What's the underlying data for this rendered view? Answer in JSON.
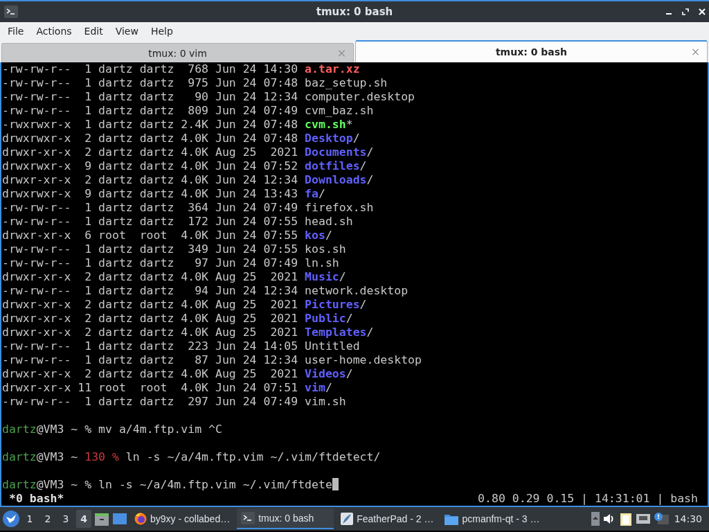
{
  "window": {
    "title": "tmux: 0 bash"
  },
  "menu": [
    "File",
    "Actions",
    "Edit",
    "View",
    "Help"
  ],
  "tabs": [
    {
      "label": "tmux: 0 vim",
      "selected": false
    },
    {
      "label": "tmux: 0 bash",
      "selected": true
    }
  ],
  "listing": [
    {
      "info": "-rw-rw-r--  1 dartz dartz  768 Jun 24 14:30 ",
      "name": "a.tar.xz",
      "kind": "archive"
    },
    {
      "info": "-rw-rw-r--  1 dartz dartz  975 Jun 24 07:48 ",
      "name": "baz_setup.sh",
      "kind": "file"
    },
    {
      "info": "-rw-rw-r--  1 dartz dartz   90 Jun 24 12:34 ",
      "name": "computer.desktop",
      "kind": "file"
    },
    {
      "info": "-rw-rw-r--  1 dartz dartz  809 Jun 24 07:49 ",
      "name": "cvm_baz.sh",
      "kind": "file"
    },
    {
      "info": "-rwxrwxr-x  1 dartz dartz 2.4K Jun 24 07:48 ",
      "name": "cvm.sh",
      "kind": "exec",
      "suffix": "*"
    },
    {
      "info": "drwxrwxr-x  2 dartz dartz 4.0K Jun 24 07:48 ",
      "name": "Desktop",
      "kind": "dir",
      "suffix": "/"
    },
    {
      "info": "drwxr-xr-x  2 dartz dartz 4.0K Aug 25  2021 ",
      "name": "Documents",
      "kind": "dir",
      "suffix": "/"
    },
    {
      "info": "drwxrwxr-x  9 dartz dartz 4.0K Jun 24 07:52 ",
      "name": "dotfiles",
      "kind": "dir",
      "suffix": "/"
    },
    {
      "info": "drwxr-xr-x  2 dartz dartz 4.0K Jun 24 12:34 ",
      "name": "Downloads",
      "kind": "dir",
      "suffix": "/"
    },
    {
      "info": "drwxrwxr-x  9 dartz dartz 4.0K Jun 24 13:43 ",
      "name": "fa",
      "kind": "dir",
      "suffix": "/"
    },
    {
      "info": "-rw-rw-r--  1 dartz dartz  364 Jun 24 07:49 ",
      "name": "firefox.sh",
      "kind": "file"
    },
    {
      "info": "-rw-rw-r--  1 dartz dartz  172 Jun 24 07:55 ",
      "name": "head.sh",
      "kind": "file"
    },
    {
      "info": "drwxr-xr-x  6 root  root  4.0K Jun 24 07:55 ",
      "name": "kos",
      "kind": "dir",
      "suffix": "/"
    },
    {
      "info": "-rw-rw-r--  1 dartz dartz  349 Jun 24 07:55 ",
      "name": "kos.sh",
      "kind": "file"
    },
    {
      "info": "-rw-rw-r--  1 dartz dartz   97 Jun 24 07:49 ",
      "name": "ln.sh",
      "kind": "file"
    },
    {
      "info": "drwxr-xr-x  2 dartz dartz 4.0K Aug 25  2021 ",
      "name": "Music",
      "kind": "dir",
      "suffix": "/"
    },
    {
      "info": "-rw-rw-r--  1 dartz dartz   94 Jun 24 12:34 ",
      "name": "network.desktop",
      "kind": "file"
    },
    {
      "info": "drwxr-xr-x  2 dartz dartz 4.0K Aug 25  2021 ",
      "name": "Pictures",
      "kind": "dir",
      "suffix": "/"
    },
    {
      "info": "drwxr-xr-x  2 dartz dartz 4.0K Aug 25  2021 ",
      "name": "Public",
      "kind": "dir",
      "suffix": "/"
    },
    {
      "info": "drwxr-xr-x  2 dartz dartz 4.0K Aug 25  2021 ",
      "name": "Templates",
      "kind": "dir",
      "suffix": "/"
    },
    {
      "info": "-rw-rw-r--  1 dartz dartz  223 Jun 24 14:05 ",
      "name": "Untitled",
      "kind": "file"
    },
    {
      "info": "-rw-rw-r--  1 dartz dartz   87 Jun 24 12:34 ",
      "name": "user-home.desktop",
      "kind": "file"
    },
    {
      "info": "drwxr-xr-x  2 dartz dartz 4.0K Aug 25  2021 ",
      "name": "Videos",
      "kind": "dir",
      "suffix": "/"
    },
    {
      "info": "drwxr-xr-x 11 root  root  4.0K Jun 24 07:51 ",
      "name": "vim",
      "kind": "dir",
      "suffix": "/"
    },
    {
      "info": "-rw-rw-r--  1 dartz dartz  297 Jun 24 07:49 ",
      "name": "vim.sh",
      "kind": "file"
    }
  ],
  "prompts": [
    {
      "user": "dartz",
      "host": "@VM3 ~ ",
      "symbol": "%",
      "command": " mv a/4m.ftp.vim ^C",
      "cursor": false
    },
    {
      "user": "dartz",
      "host": "@VM3 ~ ",
      "code": "130 ",
      "symbol": "%",
      "command": " ln -s ~/a/4m.ftp.vim ~/.vim/ftdetect/",
      "cursor": false
    },
    {
      "user": "dartz",
      "host": "@VM3 ~ ",
      "symbol": "%",
      "command": " ln -s ~/a/4m.ftp.vim ~/.vim/ftdete",
      "cursor": true
    }
  ],
  "status_bar": {
    "window": "*0 bash*",
    "right": "0.80 0.29 0.15 | 14:31:01 | bash"
  },
  "taskbar": {
    "workspaces": [
      {
        "label": "1",
        "selected": false
      },
      {
        "label": "2",
        "selected": false
      },
      {
        "label": "3",
        "selected": false
      },
      {
        "label": "4",
        "selected": true
      }
    ],
    "tasks": [
      {
        "label": "by9xy - collabed…",
        "kind": "browser",
        "selected": false
      },
      {
        "label": "tmux: 0 bash",
        "kind": "terminal",
        "selected": true
      },
      {
        "label": "FeatherPad - 2 …",
        "kind": "editor",
        "selected": false
      },
      {
        "label": "pcmanfm-qt - 3 …",
        "kind": "folder",
        "selected": false
      }
    ],
    "clock": "14:30"
  }
}
